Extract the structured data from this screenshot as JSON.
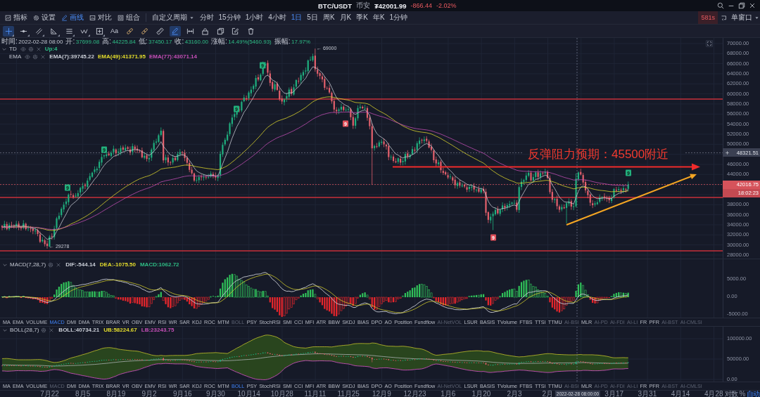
{
  "title_bar": {
    "symbol": "BTC/USDT",
    "exchange": "币安",
    "price": "₮42001.99",
    "change": "-866.44",
    "change_percent": "-2.02%",
    "down": true
  },
  "main_toolbar": {
    "tools": [
      {
        "label": "指标",
        "selected": false
      },
      {
        "label": "设置",
        "selected": false
      },
      {
        "label": "画线",
        "selected": true
      },
      {
        "label": "对比",
        "selected": false
      },
      {
        "label": "组合",
        "selected": false
      }
    ],
    "period_menu": "自定义周期",
    "periods": [
      {
        "label": "分时",
        "selected": false
      },
      {
        "label": "15分钟",
        "selected": false
      },
      {
        "label": "1小时",
        "selected": false
      },
      {
        "label": "4小时",
        "selected": false
      },
      {
        "label": "1日",
        "selected": true
      },
      {
        "label": "5日",
        "selected": false
      },
      {
        "label": "周K",
        "selected": false
      },
      {
        "label": "月K",
        "selected": false
      },
      {
        "label": "季K",
        "selected": false
      },
      {
        "label": "年K",
        "selected": false
      },
      {
        "label": "1分钟",
        "selected": false
      }
    ],
    "timer": "581s",
    "window_mode": "单窗口"
  },
  "drawing_toolbar": [
    {
      "selected": true,
      "menu": true
    },
    {
      "selected": false,
      "menu": true
    },
    {
      "selected": false,
      "menu": true
    },
    {
      "selected": false,
      "menu": true
    },
    {
      "selected": false,
      "menu": true
    },
    {
      "selected": false,
      "menu": true
    },
    {
      "selected": false,
      "menu": true
    },
    {
      "label": "Aa",
      "selected": false,
      "menu": false
    },
    {
      "selected": false,
      "menu": false
    },
    {
      "selected": false,
      "menu": false
    },
    {
      "selected": false,
      "menu": false
    },
    {
      "selected": true,
      "menu": false
    },
    {
      "selected": false,
      "menu": false
    },
    {
      "selected": false,
      "menu": false
    },
    {
      "selected": false,
      "menu": false
    },
    {
      "selected": false,
      "menu": false
    },
    {
      "selected": false,
      "menu": false
    }
  ],
  "legend": {
    "time_label": "时间:",
    "time": "2022-02-28 08:00",
    "up": true,
    "fields": [
      {
        "label": "开:",
        "value": "37699.08"
      },
      {
        "label": "高:",
        "value": "44225.84"
      },
      {
        "label": "低:",
        "value": "37450.17"
      },
      {
        "label": "收:",
        "value": "43160.00"
      },
      {
        "label": "涨幅:",
        "value": "14.49%(5460.93)"
      },
      {
        "label": "振幅:",
        "value": "17.97%"
      }
    ]
  },
  "overlays": {
    "expanded": true,
    "items": [
      {
        "name": "TD",
        "values": [
          {
            "text": "Up:4",
            "color": "#2ebd85"
          }
        ]
      },
      {
        "name": "EMA",
        "values": [
          {
            "text": "EMA(7):39745.22",
            "color": "#c9cdd6"
          },
          {
            "text": "EMA(49):41371.95",
            "color": "#e3dc2c"
          },
          {
            "text": "EMA(77):43071.14",
            "color": "#c64fb8"
          }
        ]
      }
    ]
  },
  "price_axis": [
    "70000.00",
    "68000.00",
    "66000.00",
    "64000.00",
    "62000.00",
    "60000.00",
    "58000.00",
    "56000.00",
    "54000.00",
    "52000.00",
    "50000.00",
    "46000.00",
    "44000.00",
    "38000.00",
    "36000.00",
    "34000.00",
    "32000.00",
    "30000.00",
    "28000.00"
  ],
  "price_tags": [
    {
      "kind": "crosshair",
      "text": "48321.51"
    },
    {
      "kind": "last",
      "text": "42016.75"
    },
    {
      "kind": "countdown",
      "text": "18:02:23"
    }
  ],
  "extremes": [
    {
      "kind": "high",
      "text": "← 69000"
    },
    {
      "kind": "low",
      "text": "← 29278"
    }
  ],
  "td_markers": [
    {
      "kind": "buy",
      "label": "9"
    },
    {
      "kind": "buy",
      "label": "9"
    },
    {
      "kind": "buy",
      "label": "9"
    },
    {
      "kind": "buy",
      "label": "9"
    },
    {
      "kind": "sell",
      "label": "9"
    },
    {
      "kind": "sell",
      "label": "9"
    },
    {
      "kind": "buy",
      "label": "9"
    }
  ],
  "annotation": "反弹阻力预期：45500附近",
  "macd_panel": {
    "title": "MACD(7,28,7)",
    "expanded": true,
    "values": [
      {
        "text": "DIF:-544.14",
        "color": "#c9cdd6"
      },
      {
        "text": "DEA:-1075.50",
        "color": "#e3dc2c"
      },
      {
        "text": "MACD:1062.72",
        "color": "#2ebd85"
      }
    ],
    "axis": [
      "5000.00",
      "0.00",
      "-5000.00"
    ]
  },
  "indicator_tabs_upper": [
    {
      "label": "MA",
      "selected": false,
      "disabled": false
    },
    {
      "label": "EMA",
      "selected": false,
      "disabled": false
    },
    {
      "label": "VOLUME",
      "selected": false,
      "disabled": false
    },
    {
      "label": "MACD",
      "selected": true,
      "disabled": false
    },
    {
      "label": "DMI",
      "selected": false,
      "disabled": false
    },
    {
      "label": "DMA",
      "selected": false,
      "disabled": false
    },
    {
      "label": "TRIX",
      "selected": false,
      "disabled": false
    },
    {
      "label": "BRAR",
      "selected": false,
      "disabled": false
    },
    {
      "label": "VR",
      "selected": false,
      "disabled": false
    },
    {
      "label": "OBV",
      "selected": false,
      "disabled": false
    },
    {
      "label": "EMV",
      "selected": false,
      "disabled": false
    },
    {
      "label": "RSI",
      "selected": false,
      "disabled": false
    },
    {
      "label": "WR",
      "selected": false,
      "disabled": false
    },
    {
      "label": "SAR",
      "selected": false,
      "disabled": false
    },
    {
      "label": "KDJ",
      "selected": false,
      "disabled": false
    },
    {
      "label": "ROC",
      "selected": false,
      "disabled": false
    },
    {
      "label": "MTM",
      "selected": false,
      "disabled": false
    },
    {
      "label": "BOLL",
      "selected": false,
      "disabled": true
    },
    {
      "label": "PSY",
      "selected": false,
      "disabled": false
    },
    {
      "label": "StochRSI",
      "selected": false,
      "disabled": false
    },
    {
      "label": "SMI",
      "selected": false,
      "disabled": false
    },
    {
      "label": "CCI",
      "selected": false,
      "disabled": false
    },
    {
      "label": "MFI",
      "selected": false,
      "disabled": false
    },
    {
      "label": "ATR",
      "selected": false,
      "disabled": false
    },
    {
      "label": "BBW",
      "selected": false,
      "disabled": false
    },
    {
      "label": "SKDJ",
      "selected": false,
      "disabled": false
    },
    {
      "label": "BIAS",
      "selected": false,
      "disabled": false
    },
    {
      "label": "DPO",
      "selected": false,
      "disabled": false
    },
    {
      "label": "AO",
      "selected": false,
      "disabled": false
    },
    {
      "label": "Position",
      "selected": false,
      "disabled": false
    },
    {
      "label": "Fundflow",
      "selected": false,
      "disabled": false
    },
    {
      "label": "AI-NetVOL",
      "selected": false,
      "disabled": true
    },
    {
      "label": "LSUR",
      "selected": false,
      "disabled": false
    },
    {
      "label": "BASIS",
      "selected": false,
      "disabled": false
    },
    {
      "label": "TVolume",
      "selected": false,
      "disabled": false
    },
    {
      "label": "FTBS",
      "selected": false,
      "disabled": false
    },
    {
      "label": "TTSI",
      "selected": false,
      "disabled": false
    },
    {
      "label": "TTMU",
      "selected": false,
      "disabled": false
    },
    {
      "label": "AI-BSI",
      "selected": false,
      "disabled": true
    },
    {
      "label": "MLR",
      "selected": false,
      "disabled": false
    },
    {
      "label": "AI-PD",
      "selected": false,
      "disabled": true
    },
    {
      "label": "AI-FDI",
      "selected": false,
      "disabled": true
    },
    {
      "label": "AI-LI",
      "selected": false,
      "disabled": true
    },
    {
      "label": "FR",
      "selected": false,
      "disabled": false
    },
    {
      "label": "PFR",
      "selected": false,
      "disabled": false
    },
    {
      "label": "AI-BST",
      "selected": false,
      "disabled": true
    },
    {
      "label": "AI-CMLSI",
      "selected": false,
      "disabled": true
    }
  ],
  "boll_panel": {
    "title": "BOLL(28,7)",
    "expanded": true,
    "values": [
      {
        "text": "BOLL:40734.21",
        "color": "#c9cdd6"
      },
      {
        "text": "UB:58224.67",
        "color": "#e3dc2c"
      },
      {
        "text": "LB:23243.75",
        "color": "#c64fb8"
      }
    ],
    "axis": [
      "100000.00",
      "50000.00",
      "0.00"
    ]
  },
  "indicator_tabs_lower": [
    {
      "label": "MA",
      "selected": false,
      "disabled": false
    },
    {
      "label": "EMA",
      "selected": false,
      "disabled": false
    },
    {
      "label": "VOLUME",
      "selected": false,
      "disabled": false
    },
    {
      "label": "MACD",
      "selected": false,
      "disabled": true
    },
    {
      "label": "DMI",
      "selected": false,
      "disabled": false
    },
    {
      "label": "DMA",
      "selected": false,
      "disabled": false
    },
    {
      "label": "TRIX",
      "selected": false,
      "disabled": false
    },
    {
      "label": "BRAR",
      "selected": false,
      "disabled": false
    },
    {
      "label": "VR",
      "selected": false,
      "disabled": false
    },
    {
      "label": "OBV",
      "selected": false,
      "disabled": false
    },
    {
      "label": "EMV",
      "selected": false,
      "disabled": false
    },
    {
      "label": "RSI",
      "selected": false,
      "disabled": false
    },
    {
      "label": "WR",
      "selected": false,
      "disabled": false
    },
    {
      "label": "SAR",
      "selected": false,
      "disabled": false
    },
    {
      "label": "KDJ",
      "selected": false,
      "disabled": false
    },
    {
      "label": "ROC",
      "selected": false,
      "disabled": false
    },
    {
      "label": "MTM",
      "selected": false,
      "disabled": false
    },
    {
      "label": "BOLL",
      "selected": true,
      "disabled": false
    },
    {
      "label": "PSY",
      "selected": false,
      "disabled": false
    },
    {
      "label": "StochRSI",
      "selected": false,
      "disabled": false
    },
    {
      "label": "SMI",
      "selected": false,
      "disabled": false
    },
    {
      "label": "CCI",
      "selected": false,
      "disabled": false
    },
    {
      "label": "MFI",
      "selected": false,
      "disabled": false
    },
    {
      "label": "ATR",
      "selected": false,
      "disabled": false
    },
    {
      "label": "BBW",
      "selected": false,
      "disabled": false
    },
    {
      "label": "SKDJ",
      "selected": false,
      "disabled": false
    },
    {
      "label": "BIAS",
      "selected": false,
      "disabled": false
    },
    {
      "label": "DPO",
      "selected": false,
      "disabled": false
    },
    {
      "label": "AO",
      "selected": false,
      "disabled": false
    },
    {
      "label": "Position",
      "selected": false,
      "disabled": false
    },
    {
      "label": "Fundflow",
      "selected": false,
      "disabled": false
    },
    {
      "label": "AI-NetVOL",
      "selected": false,
      "disabled": true
    },
    {
      "label": "LSUR",
      "selected": false,
      "disabled": false
    },
    {
      "label": "BASIS",
      "selected": false,
      "disabled": false
    },
    {
      "label": "TVolume",
      "selected": false,
      "disabled": false
    },
    {
      "label": "FTBS",
      "selected": false,
      "disabled": false
    },
    {
      "label": "TTSI",
      "selected": false,
      "disabled": false
    },
    {
      "label": "TTMU",
      "selected": false,
      "disabled": false
    },
    {
      "label": "AI-BSI",
      "selected": false,
      "disabled": true
    },
    {
      "label": "MLR",
      "selected": false,
      "disabled": false
    },
    {
      "label": "AI-PD",
      "selected": false,
      "disabled": true
    },
    {
      "label": "AI-FDI",
      "selected": false,
      "disabled": true
    },
    {
      "label": "AI-LI",
      "selected": false,
      "disabled": true
    },
    {
      "label": "FR",
      "selected": false,
      "disabled": false
    },
    {
      "label": "PFR",
      "selected": false,
      "disabled": false
    },
    {
      "label": "AI-BST",
      "selected": false,
      "disabled": true
    },
    {
      "label": "AI-CMLSI",
      "selected": false,
      "disabled": true
    }
  ],
  "time_axis": {
    "labels": [
      "7月22",
      "8月5",
      "8月19",
      "9月2",
      "9月16",
      "9月30",
      "10月14",
      "10月28",
      "11月11",
      "11月25",
      "12月9",
      "12月23",
      "1月6",
      "1月20",
      "2月3",
      "2月",
      "3月17",
      "3月31",
      "4月14",
      "4月28"
    ],
    "crosshair": "2022-02-28 08:00:00",
    "scales": [
      {
        "label": "对数",
        "selected": false
      },
      {
        "label": "%",
        "selected": false
      },
      {
        "label": "自动",
        "selected": true
      }
    ]
  }
}
